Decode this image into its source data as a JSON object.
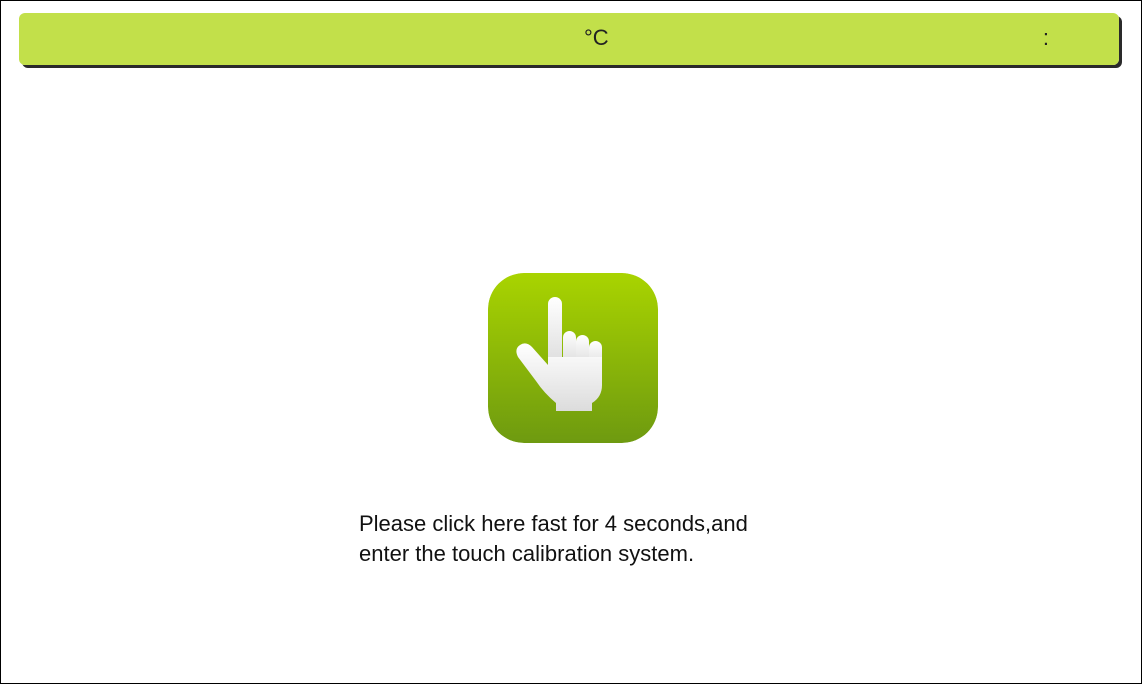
{
  "status_bar": {
    "temperature": "°C",
    "clock": ":",
    "color": "#c2e04a"
  },
  "calibration": {
    "icon": "pointing-hand-icon",
    "gradient_top": "#a9d400",
    "gradient_bottom": "#6e9a10",
    "instruction_line1": "Please click here fast for 4 seconds,and",
    "instruction_line2": "enter the touch calibration system."
  }
}
